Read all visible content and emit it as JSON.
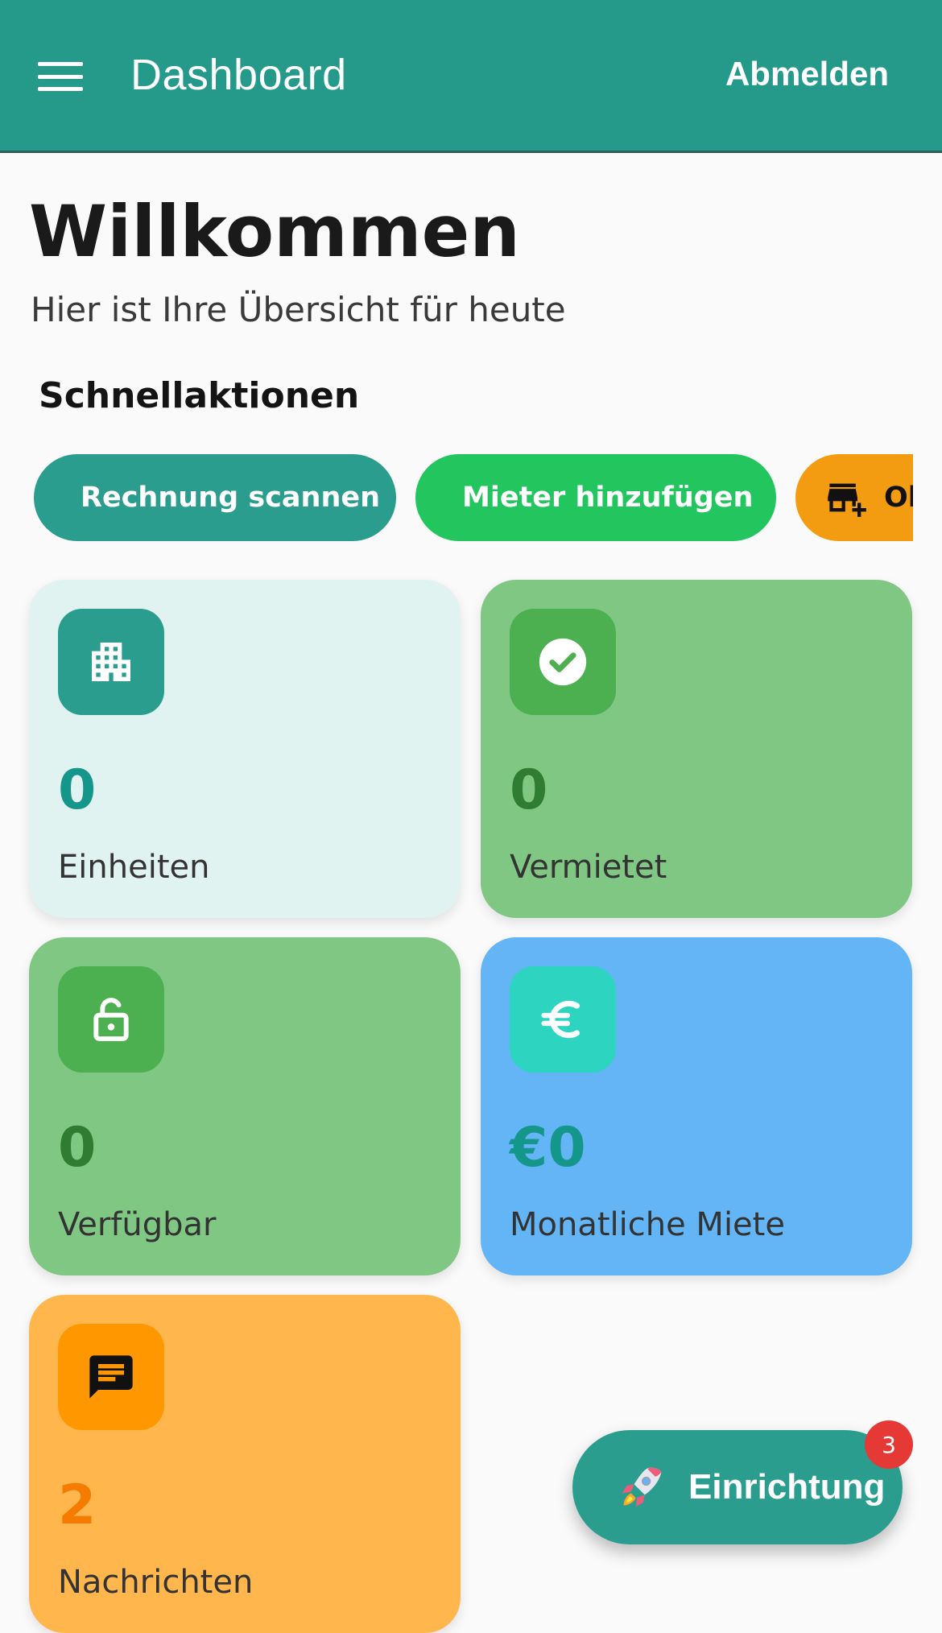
{
  "app_bar": {
    "title": "Dashboard",
    "logout_label": "Abmelden",
    "color": "#259a8a"
  },
  "header": {
    "welcome": "Willkommen",
    "subtitle": "Hier ist Ihre Übersicht für heute"
  },
  "quick_actions": {
    "title": "Schnellaktionen",
    "items": [
      {
        "label": "Rechnung scannen",
        "icon": "document-scanner-icon",
        "color": "#2a9d8f"
      },
      {
        "label": "Mieter hinzufügen",
        "icon": "person-add-icon",
        "color": "#22c55e"
      },
      {
        "label": "Ob",
        "icon": "add-business-icon",
        "color": "#f39c12"
      }
    ]
  },
  "stats": [
    {
      "value": "0",
      "label": "Einheiten",
      "icon": "apartment-icon",
      "value_color": "#14968a",
      "card_color": "#e0f3f1",
      "icon_bg": "#2a9d8f"
    },
    {
      "value": "0",
      "label": "Vermietet",
      "icon": "check-circle-icon",
      "value_color": "#2e7d32",
      "card_color": "#81c784",
      "icon_bg": "#4caf50"
    },
    {
      "value": "0",
      "label": "Verfügbar",
      "icon": "lock-open-icon",
      "value_color": "#2e7d32",
      "card_color": "#81c784",
      "icon_bg": "#4caf50"
    },
    {
      "value": "€0",
      "label": "Monatliche Miete",
      "icon": "euro-icon",
      "value_color": "#14968a",
      "card_color": "#64b5f6",
      "icon_bg": "#2dd4bf"
    },
    {
      "value": "2",
      "label": "Nachrichten",
      "icon": "chat-icon",
      "value_color": "#f57c00",
      "card_color": "#ffb74d",
      "icon_bg": "#ff9800"
    }
  ],
  "fab": {
    "label": "Einrichtung",
    "icon": "rocket-icon",
    "badge_count": "3"
  }
}
